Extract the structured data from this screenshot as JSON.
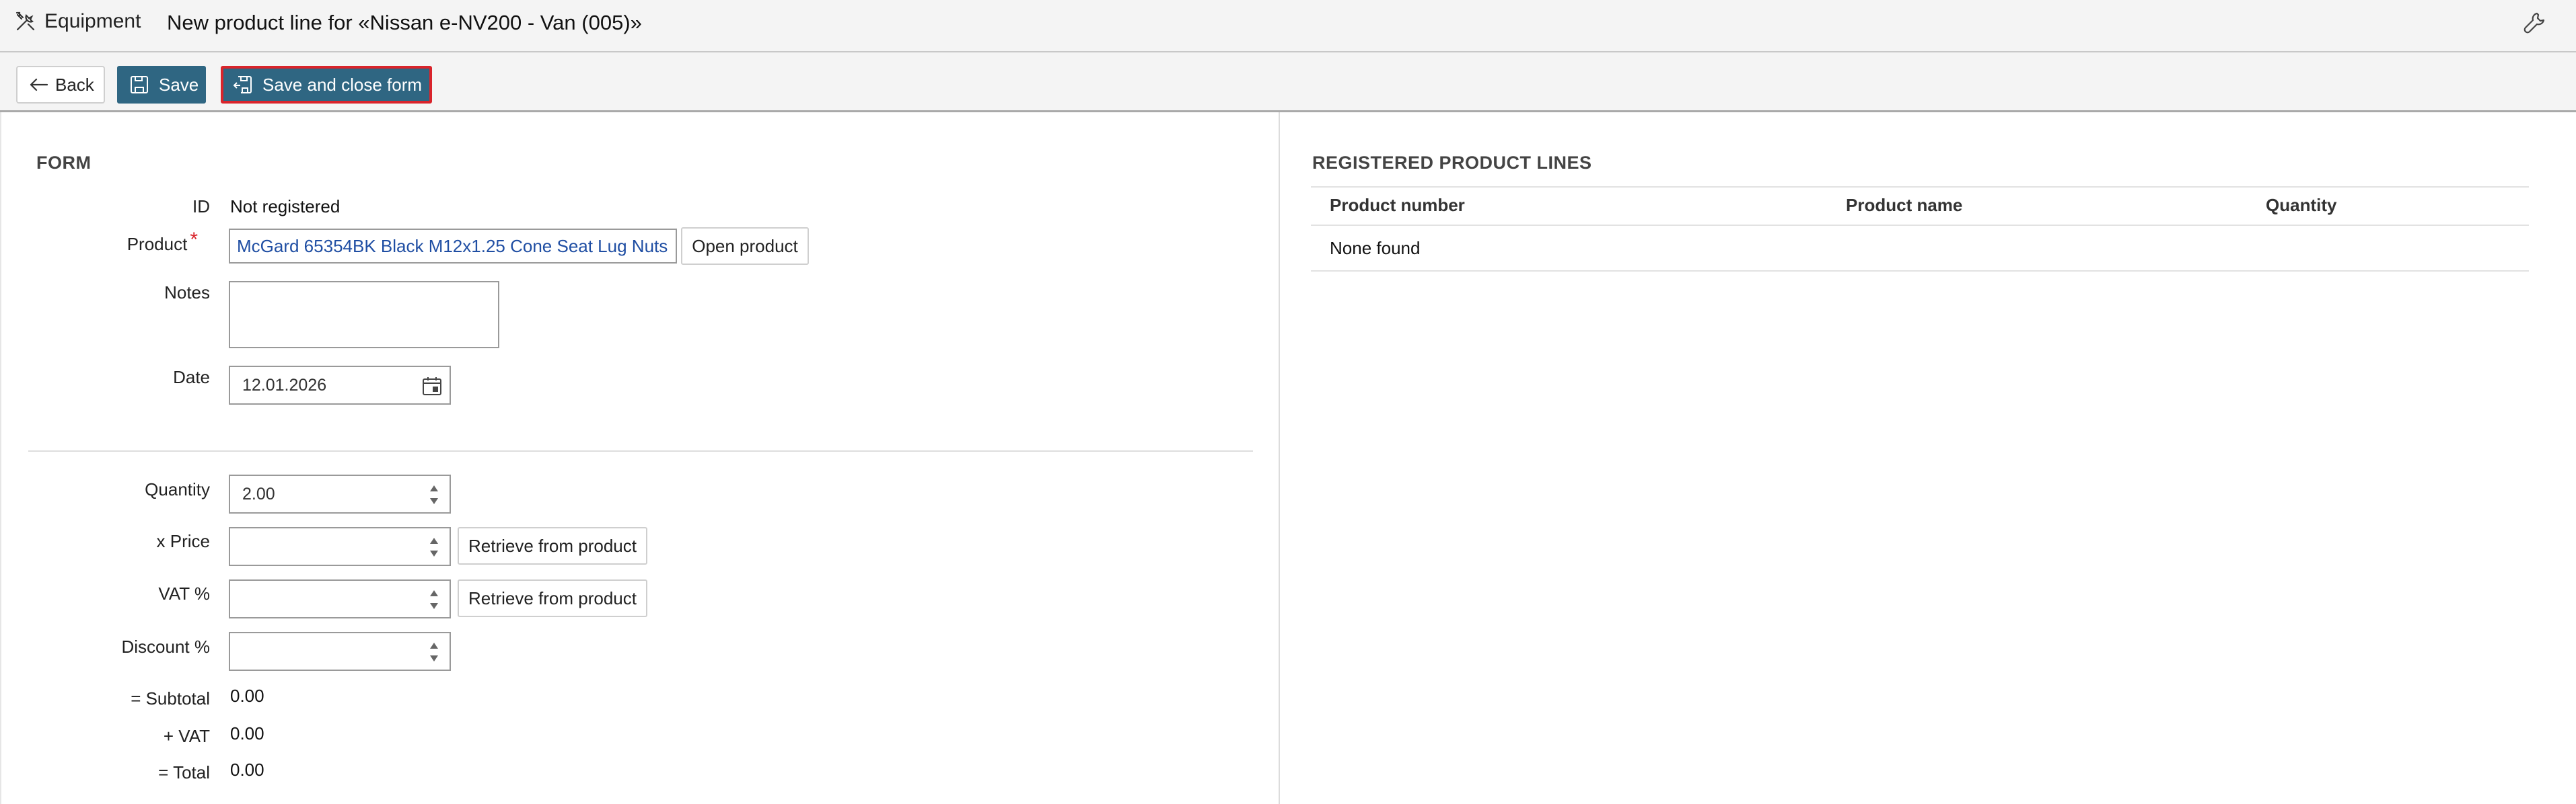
{
  "header": {
    "app_name": "Equipment",
    "title": "New product line for «Nissan e-NV200 - Van (005)»"
  },
  "toolbar": {
    "back_label": "Back",
    "save_label": "Save",
    "save_close_label": "Save and close form"
  },
  "form": {
    "section_title": "FORM",
    "id_label": "ID",
    "id_value": "Not registered",
    "product_label": "Product",
    "product_value": "McGard 65354BK Black M12x1.25 Cone Seat Lug Nuts",
    "open_product_label": "Open product",
    "notes_label": "Notes",
    "notes_value": "",
    "date_label": "Date",
    "date_value": "12.01.2026",
    "quantity_label": "Quantity",
    "quantity_value": "2.00",
    "price_label": "x Price",
    "price_value": "",
    "retrieve_price_label": "Retrieve from product",
    "vat_label": "VAT %",
    "vat_value": "",
    "retrieve_vat_label": "Retrieve from product",
    "discount_label": "Discount %",
    "discount_value": "",
    "subtotal_label": "= Subtotal",
    "subtotal_value": "0.00",
    "vat_amount_label": "+ VAT",
    "vat_amount_value": "0.00",
    "total_label": "= Total",
    "total_value": "0.00"
  },
  "registered": {
    "section_title": "REGISTERED PRODUCT LINES",
    "columns": [
      "Product number",
      "Product name",
      "Quantity"
    ],
    "empty_text": "None found"
  },
  "icons": {
    "app": "tools-icon",
    "settings": "wrench-icon",
    "back": "arrow-left-icon",
    "save": "floppy-disk-icon",
    "date": "calendar-icon"
  },
  "colors": {
    "primary_button": "#2f6682",
    "focus_outline": "#d9242b",
    "required": "#d9242b",
    "product_link": "#1f4ea3"
  }
}
